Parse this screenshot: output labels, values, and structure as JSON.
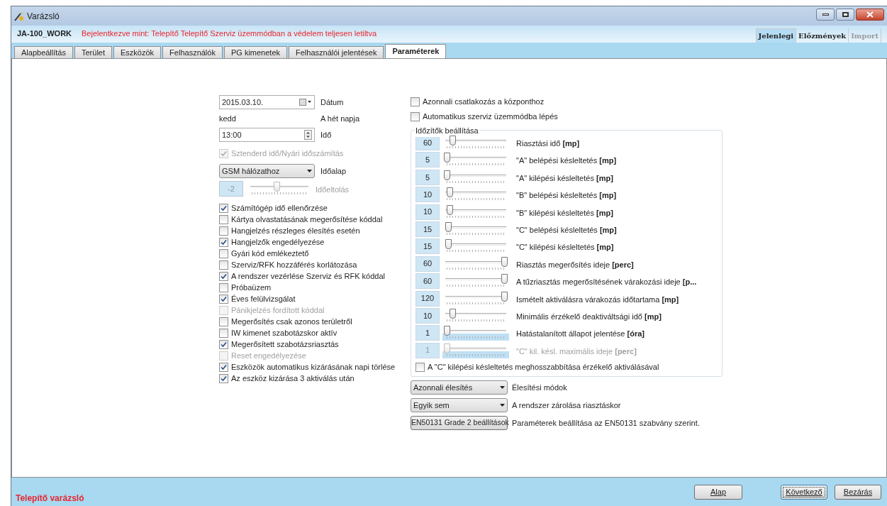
{
  "window": {
    "title": "Varázsló"
  },
  "header": {
    "device": "JA-100_WORK",
    "status": "Bejelentkezve mint: Telepítő Telepítő Szerviz üzemmódban a védelem teljesen letiltva"
  },
  "view_tabs": [
    {
      "label": "Jelenlegi",
      "selected": true,
      "disabled": false
    },
    {
      "label": "Előzmények",
      "selected": false,
      "disabled": false
    },
    {
      "label": "Import",
      "selected": false,
      "disabled": true
    }
  ],
  "tabs": [
    {
      "label": "Alapbeállítás",
      "selected": false
    },
    {
      "label": "Terület",
      "selected": false
    },
    {
      "label": "Eszközök",
      "selected": false
    },
    {
      "label": "Felhasználók",
      "selected": false
    },
    {
      "label": "PG kimenetek",
      "selected": false
    },
    {
      "label": "Felhasználói jelentések",
      "selected": false
    },
    {
      "label": "Paraméterek",
      "selected": true
    }
  ],
  "date": {
    "value": "2015.03.10.",
    "label": "Dátum"
  },
  "weekday": {
    "value": "kedd",
    "label": "A hét napja"
  },
  "time": {
    "value": "13:00",
    "label": "Idő"
  },
  "dst": {
    "label": "Sztenderd idő/Nyári időszámítás",
    "checked": true,
    "disabled": true
  },
  "time_base": {
    "value": "GSM hálózathoz",
    "label": "Időalap"
  },
  "time_offset": {
    "value": "-2",
    "label": "Időeltolás",
    "level": 0.45,
    "disabled": true
  },
  "options": [
    {
      "label": "Számítógép idő ellenőrzése",
      "checked": true,
      "disabled": false
    },
    {
      "label": "Kártya olvastatásának megerősítése kóddal",
      "checked": false,
      "disabled": false
    },
    {
      "label": "Hangjelzés részleges élesítés esetén",
      "checked": false,
      "disabled": false
    },
    {
      "label": "Hangjelzők engedélyezése",
      "checked": true,
      "disabled": false
    },
    {
      "label": "Gyári kód emlékeztető",
      "checked": false,
      "disabled": false
    },
    {
      "label": "Szerviz/RFK hozzáférés korlátozása",
      "checked": false,
      "disabled": false
    },
    {
      "label": "A rendszer vezérlése Szerviz és RFK kóddal",
      "checked": true,
      "disabled": false
    },
    {
      "label": "Próbaüzem",
      "checked": false,
      "disabled": false
    },
    {
      "label": "Éves felülvizsgálat",
      "checked": true,
      "disabled": false
    },
    {
      "label": "Pánikjelzés fordított kóddal",
      "checked": false,
      "disabled": true
    },
    {
      "label": "Megerősítés csak azonos területről",
      "checked": false,
      "disabled": false
    },
    {
      "label": "IW kimenet szabotázskor aktív",
      "checked": false,
      "disabled": false
    },
    {
      "label": "Megerősített szabotázsriasztás",
      "checked": true,
      "disabled": false
    },
    {
      "label": "Reset engedélyezése",
      "checked": false,
      "disabled": true
    },
    {
      "label": "Eszközök automatikus kizárásának napi törlése",
      "checked": true,
      "disabled": false
    },
    {
      "label": "Az eszköz kizárása 3 aktiválás után",
      "checked": true,
      "disabled": false
    }
  ],
  "top_options": [
    {
      "label": "Azonnali csatlakozás a központhoz",
      "checked": false
    },
    {
      "label": "Automatikus szerviz üzemmódba lépés",
      "checked": false
    }
  ],
  "timers": {
    "title": "Időzítők beállítása",
    "rows": [
      {
        "value": "60",
        "level": 0.1,
        "label": "Riasztási idő **[mp]**",
        "disabled": false,
        "highlight": false
      },
      {
        "value": "5",
        "level": 0.0,
        "label": "\"A\" belépési késleltetés **[mp]**",
        "disabled": false,
        "highlight": false
      },
      {
        "value": "5",
        "level": 0.0,
        "label": "\"A\" kilépési késleltetés **[mp]**",
        "disabled": false,
        "highlight": false
      },
      {
        "value": "10",
        "level": 0.05,
        "label": "\"B\" belépési késleltetés **[mp]**",
        "disabled": false,
        "highlight": false
      },
      {
        "value": "10",
        "level": 0.05,
        "label": "\"B\" kilépési késleltetés **[mp]**",
        "disabled": false,
        "highlight": false
      },
      {
        "value": "15",
        "level": 0.02,
        "label": "\"C\" belépési késleltetés **[mp]**",
        "disabled": false,
        "highlight": false
      },
      {
        "value": "15",
        "level": 0.02,
        "label": "\"C\" kilépési késleltetés **[mp]**",
        "disabled": false,
        "highlight": false
      },
      {
        "value": "60",
        "level": 1.0,
        "label": "Riasztás megerősítés ideje **[perc]**",
        "disabled": false,
        "highlight": false
      },
      {
        "value": "60",
        "level": 1.0,
        "label": "A tűzriasztás megerősítésének várakozási ideje **[p...**",
        "disabled": false,
        "highlight": false
      },
      {
        "value": "120",
        "level": 1.0,
        "label": "Ismételt aktiválásra várakozás időtartama **[mp]**",
        "disabled": false,
        "highlight": false
      },
      {
        "value": "10",
        "level": 0.1,
        "label": "Minimális érzékelő deaktiváltsági idő **[mp]**",
        "disabled": false,
        "highlight": false
      },
      {
        "value": "1",
        "level": 0.0,
        "label": "Hatástalanított állapot jelentése **[óra]**",
        "disabled": false,
        "highlight": true
      },
      {
        "value": "1",
        "level": 0.0,
        "label": "\"C\" kil. késl. maximális ideje **[perc]**",
        "disabled": true,
        "highlight": true
      }
    ],
    "extend": {
      "label": "A \"C\" kilépési késleltetés meghosszabbítása érzékelő aktiválásával",
      "checked": false
    }
  },
  "arming": {
    "value": "Azonnali élesítés",
    "label": "Élesítési módok"
  },
  "lock": {
    "value": "Egyik sem",
    "label": "A rendszer zárolása riasztáskor"
  },
  "en_button": {
    "label": "EN50131 Grade 2 beállítások",
    "description": "Paraméterek beállítása az EN50131 szabvány szerint."
  },
  "footer": {
    "title": "Telepítő varázsló",
    "buttons": [
      {
        "label": "Alap",
        "focused": false
      },
      {
        "label": "Következő",
        "focused": true
      },
      {
        "label": "Bezárás",
        "focused": false
      }
    ]
  }
}
